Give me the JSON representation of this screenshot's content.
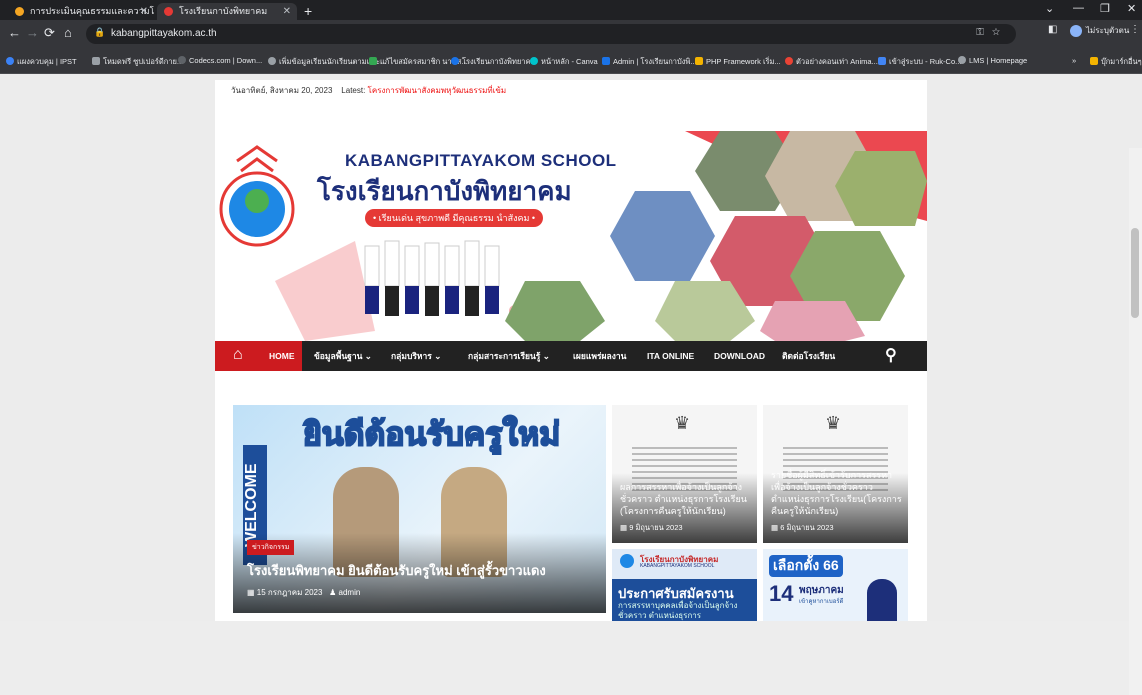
{
  "browser": {
    "tabs": [
      {
        "label": "การประเมินคุณธรรมและความโปร่งใส (I",
        "active": false
      },
      {
        "label": "โรงเรียนกาบังพิทยาคม",
        "active": true
      }
    ],
    "url": "kabangpittayakom.ac.th",
    "profile_label": "ไม่ระบุตัวตน",
    "bookmarks": [
      "แผงควบคุม | IPST",
      "โหมดฟรี ซูปเปอร์ดีกาย...",
      "Codecs.com | Down...",
      "เพิ่มข้อมูลเรียนนักเรียนตามและ...",
      "แก้ไขสมัครสมาชิก นาฬส...",
      "โรงเรียนกาบังพิทยาคม",
      "หน้าหลัก - Canva",
      "Admin | โรงเรียนกาบังพิ...",
      "PHP Framework เริ่ม...",
      "ตัวอย่างคอนเท่า Anima...",
      "เข้าสู่ระบบ - Ruk-Co...",
      "LMS | Homepage",
      "บุ๊กมาร์กอื่นๆ"
    ]
  },
  "site": {
    "date": "วันอาทิตย์, สิงหาคม 20, 2023",
    "latest_label": "Latest:",
    "latest_text": "โครงการพัฒนาสังคมพหุวัฒนธรรมที่เข้ม",
    "banner": {
      "school_en": "KABANGPITTAYAKOM SCHOOL",
      "school_th": "โรงเรียนกาบังพิทยาคม",
      "motto": "• เรียนเด่น สุขภาพดี มีคุณธรรม นำสังคม •"
    },
    "menu": [
      "HOME",
      "ข้อมูลพื้นฐาน",
      "กลุ่มบริหาร",
      "กลุ่มสาระการเรียนรู้",
      "เผยแพร่ผลงาน",
      "ITA ONLINE",
      "DOWNLOAD",
      "ติดต่อโรงเรียน"
    ],
    "featured": {
      "headline": "ยินดีต้อนรับครูใหม่",
      "welcome_side": "WELCOME",
      "category": "ข่าวกิจกรรม",
      "title": "โรงเรียนพิทยาคม ยินดีต้อนรับครูใหม่ เข้าสู่รั้วขาวแดง",
      "date": "15 กรกฎาคม 2023",
      "author": "admin"
    },
    "cards": [
      {
        "title": "ผลการสรรหาเพื่อจ้างเป็นลูกจ้างชั่วคราว ตำแหน่งธุรการโรงเรียน (โครงการคืนครูให้นักเรียน)",
        "date": "9 มิถุนายน 2023"
      },
      {
        "title": "รายชื่อผู้มีสิทธิ์เข้ารับการสรรหาเพื่อจ้างเป็นลูกจ้างชั่วคราว ตำแหน่งธุรการโรงเรียน(โครงการคืนครูให้นักเรียน)",
        "date": "6 มิถุนายน 2023"
      },
      {
        "title": "ประกาศรับสมัครงาน",
        "subtitle": "การสรรหาบุคคลเพื่อจ้างเป็นลูกจ้างชั่วคราว ตำแหน่งธุรการ",
        "school": "โรงเรียนกาบังพิทยาคม",
        "school_en": "KABANGPITTAYAKOM SCHOOL"
      },
      {
        "title": "เลือกตั้ง 66",
        "day": "14",
        "month": "พฤษภาคม",
        "sub": "เข้าคูหากาเบอร์ดี"
      }
    ]
  },
  "colors": {
    "accent_red": "#cc1b1f",
    "menu_bg": "#222222",
    "banner_navy": "#1d2f7a"
  }
}
